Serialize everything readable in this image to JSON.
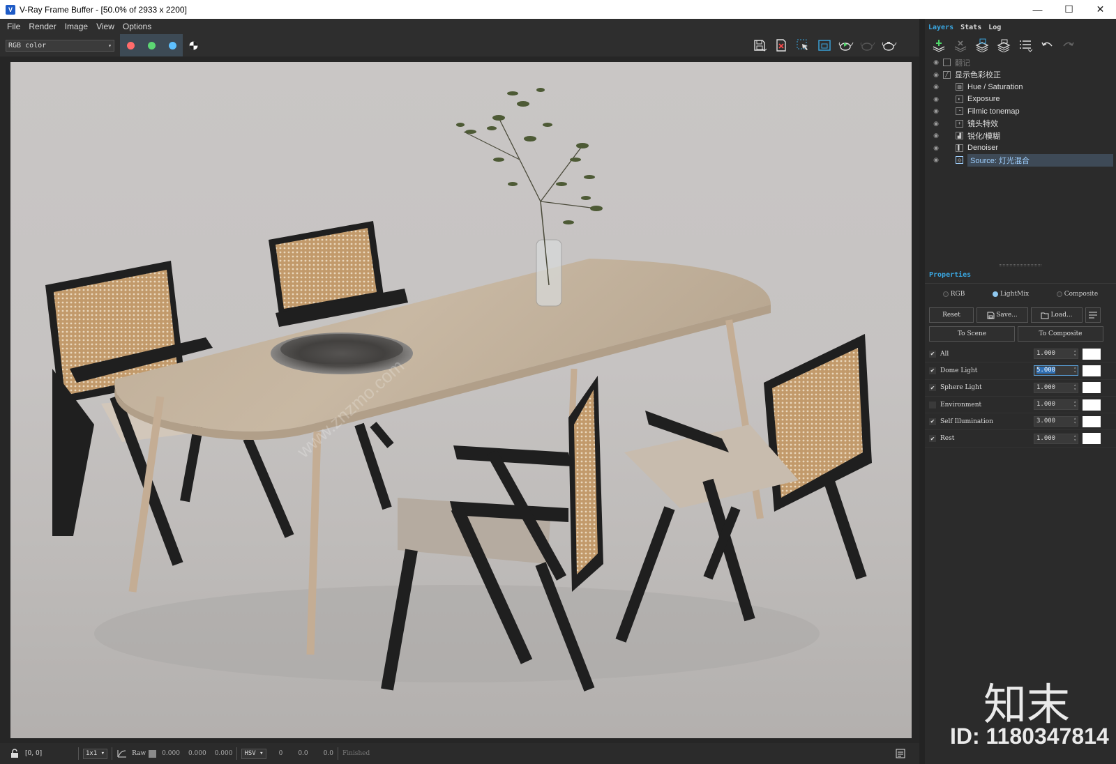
{
  "window": {
    "title": "V-Ray Frame Buffer - [50.0% of 2933 x 2200]",
    "minimize": "—",
    "maximize": "☐",
    "close": "✕"
  },
  "menu": [
    "File",
    "Render",
    "Image",
    "View",
    "Options"
  ],
  "toolbar": {
    "channel": "RGB color",
    "channel_colors": [
      "#ff5b5b",
      "#4fd86a",
      "#4fb7ff"
    ]
  },
  "side": {
    "tabs": [
      "Layers",
      "Stats",
      "Log"
    ],
    "layers": [
      {
        "label": "翻记",
        "depth": 0,
        "dim": true
      },
      {
        "label": "显示色彩校正",
        "depth": 0
      },
      {
        "label": "Hue / Saturation",
        "depth": 1
      },
      {
        "label": "Exposure",
        "depth": 1
      },
      {
        "label": "Filmic tonemap",
        "depth": 1
      },
      {
        "label": "镜头特效",
        "depth": 1
      },
      {
        "label": "锐化/模糊",
        "depth": 1
      },
      {
        "label": "Denoiser",
        "depth": 1
      },
      {
        "label": "Source: 灯光混合",
        "depth": 1,
        "selected": true
      }
    ],
    "properties_title": "Properties",
    "modes": [
      "RGB",
      "LightMix",
      "Composite"
    ],
    "buttons": {
      "reset": "Reset",
      "save": "Save...",
      "load": "Load...",
      "to_scene": "To Scene",
      "to_composite": "To Composite"
    },
    "lights": [
      {
        "name": "All",
        "value": "1.000",
        "checked": true
      },
      {
        "name": "Dome Light",
        "value": "5.000",
        "checked": true,
        "editing": true
      },
      {
        "name": "Sphere Light",
        "value": "1.000",
        "checked": true
      },
      {
        "name": "Environment",
        "value": "1.000",
        "checked": false
      },
      {
        "name": "Self Illumination",
        "value": "3.000",
        "checked": true
      },
      {
        "name": "Rest",
        "value": "1.000",
        "checked": true
      }
    ]
  },
  "status": {
    "coords": "[0, 0]",
    "zoom": "1x1",
    "raw": "Raw",
    "raw_values": [
      "0.000",
      "0.000",
      "0.000"
    ],
    "color_mode": "HSV",
    "hsv_values": [
      "0",
      "0.0",
      "0.0"
    ],
    "state": "Finished"
  },
  "watermark": {
    "text": "知末",
    "id": "ID: 1180347814",
    "site": "www.znzmo.com"
  }
}
